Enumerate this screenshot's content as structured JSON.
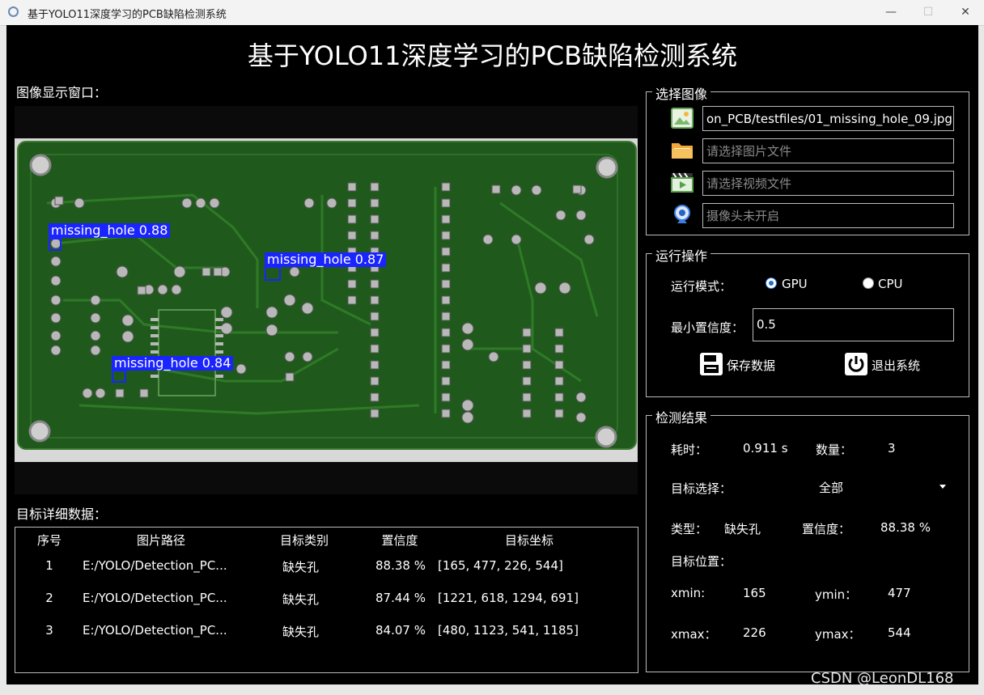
{
  "window": {
    "title": "基于YOLO11深度学习的PCB缺陷检测系统",
    "min_glyph": "—",
    "max_glyph": "☐",
    "close_glyph": "✕"
  },
  "app": {
    "title": "基于YOLO11深度学习的PCB缺陷检测系统",
    "image_window_label": "图像显示窗口：",
    "detail_label": "目标详细数据："
  },
  "detections_overlay": [
    {
      "label": "missing_hole 0.88"
    },
    {
      "label": "missing_hole 0.87"
    },
    {
      "label": "missing_hole 0.84"
    }
  ],
  "select_image": {
    "title": "选择图像",
    "image_path": "on_PCB/testfiles/01_missing_hole_09.jpg",
    "folder_placeholder": "请选择图片文件",
    "video_placeholder": "请选择视频文件",
    "camera_placeholder": "摄像头未开启"
  },
  "operation": {
    "title": "运行操作",
    "mode_label": "运行模式：",
    "mode_gpu": "GPU",
    "mode_cpu": "CPU",
    "selected_mode": "GPU",
    "conf_label": "最小置信度：",
    "conf_value": "0.5",
    "save_label": "保存数据",
    "exit_label": "退出系统"
  },
  "results": {
    "title": "检测结果",
    "time_label": "耗时：",
    "time_value": "0.911 s",
    "count_label": "数量：",
    "count_value": "3",
    "target_select_label": "目标选择：",
    "target_select_value": "全部",
    "type_label": "类型：",
    "type_value": "缺失孔",
    "conf_label": "置信度：",
    "conf_value": "88.38 %",
    "position_label": "目标位置：",
    "xmin_label": "xmin:",
    "xmin_value": "165",
    "ymin_label": "ymin：",
    "ymin_value": "477",
    "xmax_label": "xmax：",
    "xmax_value": "226",
    "ymax_label": "ymax：",
    "ymax_value": "544"
  },
  "table": {
    "headers": [
      "序号",
      "图片路径",
      "目标类别",
      "置信度",
      "目标坐标"
    ],
    "rows": [
      [
        "1",
        "E:/YOLO/Detection_PC...",
        "缺失孔",
        "88.38 %",
        "[165, 477, 226, 544]"
      ],
      [
        "2",
        "E:/YOLO/Detection_PC...",
        "缺失孔",
        "87.44 %",
        "[1221, 618, 1294, 691]"
      ],
      [
        "3",
        "E:/YOLO/Detection_PC...",
        "缺失孔",
        "84.07 %",
        "[480, 1123, 541, 1185]"
      ]
    ]
  },
  "watermark": "CSDN @LeonDL168",
  "colors": {
    "detection": "#1a24ff",
    "pcb_green": "#1f5a1c",
    "background": "#000000"
  }
}
